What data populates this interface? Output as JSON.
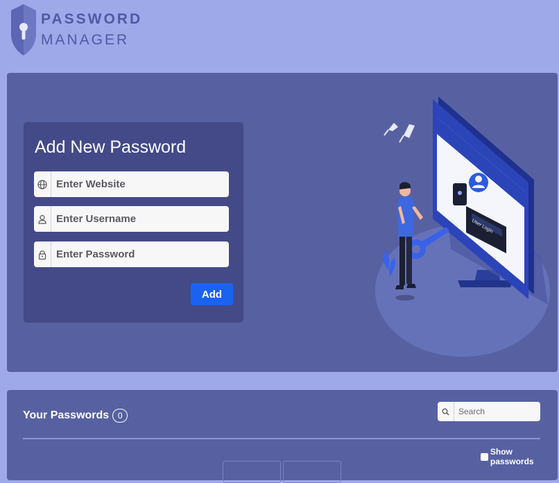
{
  "header": {
    "logo_line1": "PASSWORD",
    "logo_line2": "MANAGER"
  },
  "form": {
    "title": "Add New Password",
    "website_placeholder": "Enter Website",
    "username_placeholder": "Enter Username",
    "password_placeholder": "Enter Password",
    "add_label": "Add"
  },
  "illustration": {
    "screen_label": "User Login"
  },
  "passwords": {
    "title": "Your Passwords",
    "count": "0",
    "search_placeholder": "Search",
    "show_label": "Show passwords"
  },
  "colors": {
    "page_bg": "#9ea9ea",
    "panel_bg": "#5761a2",
    "card_bg": "#434a87",
    "accent": "#1a63f0"
  },
  "icons": {
    "website": "globe-icon",
    "username": "user-icon",
    "password": "lock-icon",
    "search": "search-icon",
    "logo": "shield-keyhole-icon"
  }
}
